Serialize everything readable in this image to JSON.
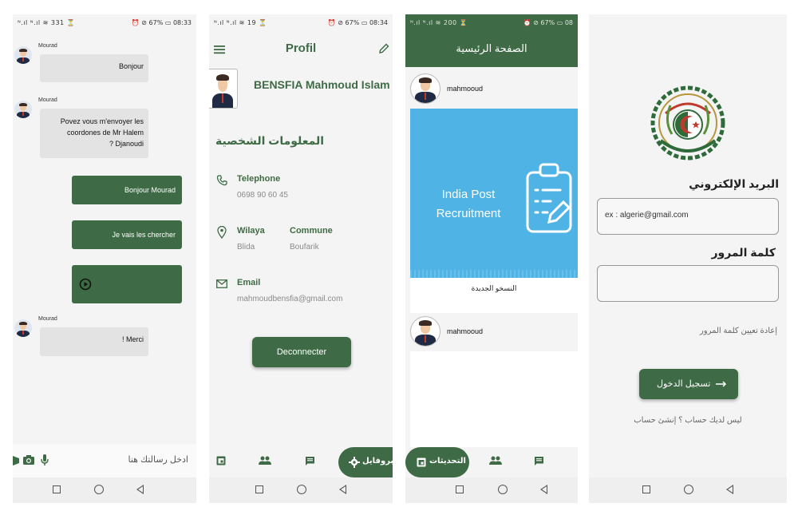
{
  "chat": {
    "status_left": "ᴺ.ıl ᴺ.ıl ≋ 331 ⏳",
    "status_right": "⏰ ⊘ 67% ▭ 08:33",
    "messages": [
      {
        "sender": "Mourad",
        "text": "Bonjour"
      },
      {
        "sender": "Mourad",
        "line1": "Povez vous m'envoyer les",
        "line2": "coordones de Mr Halem",
        "line3": "? Djanoudi"
      },
      {
        "text": "Bonjour Mourad"
      },
      {
        "text": "Je vais les chercher"
      },
      {
        "audio": true
      },
      {
        "sender": "Mourad",
        "text": "! Merci"
      }
    ],
    "input_placeholder": "ادخل رسالتك هنا"
  },
  "profile": {
    "status_left": "ᴺ.ıl ᴺ.ıl ≋ 19 ⏳",
    "status_right": "⏰ ⊘ 67% ▭ 08:34",
    "title": "Profil",
    "name": "BENSFIA Mahmoud Islam",
    "section_title": "المعلومات الشخصية",
    "telephone_label": "Telephone",
    "telephone_value": "0698 90 60 45",
    "wilaya_label": "Wilaya",
    "wilaya_value": "Blida",
    "commune_label": "Commune",
    "commune_value": "Boufarik",
    "email_label": "Email",
    "email_value": "mahmoudbensfia@gmail.com",
    "logout_label": "Deconnecter",
    "nav_active_label": "البروفايل"
  },
  "feed": {
    "status_left": "ᴺ.ıl ᴺ.ıl ≋ 200 ⏳",
    "status_right": "⏰ ⊘ 67% ▭ 08",
    "title": "الصفحة الرئيسية",
    "post_user": "mahmooud",
    "post_image_line1": "India Post",
    "post_image_line2": "Recruitment",
    "post_caption": "النسخو الجديدة",
    "post2_user": "mahmooud",
    "nav_active_label": "التحديثات"
  },
  "login": {
    "email_label": "البريد الإلكتروني",
    "email_placeholder": "ex : algerie@gmail.com",
    "password_label": "كلمة المرور",
    "forgot_label": "إعادة تعيين كلمة المرور",
    "login_button": "تسجيل الدخول",
    "signup_prompt": "ليس لديك حساب ؟ إنشئ حساب"
  },
  "colors": {
    "primary": "#3e6b45",
    "feed_image": "#4fb3e6",
    "background": "#f4f4f4"
  }
}
